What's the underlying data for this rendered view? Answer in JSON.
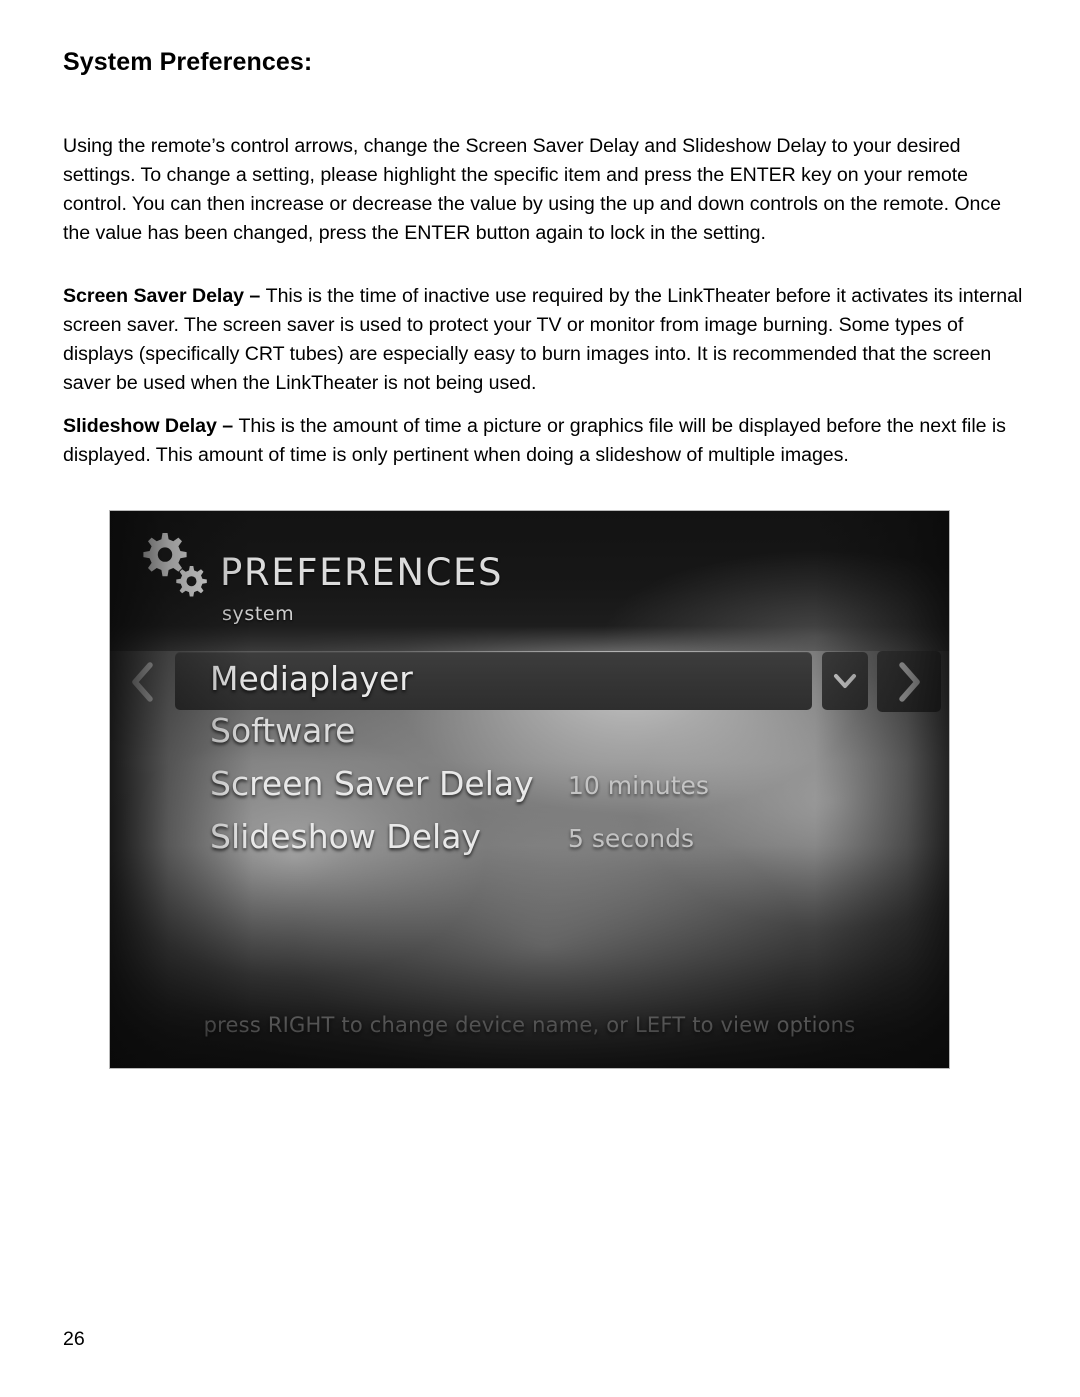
{
  "document": {
    "title": "System Preferences:",
    "paragraphs": [
      {
        "id": "intro",
        "text": "Using the remote’s control arrows, change the Screen Saver Delay and Slideshow Delay to your desired settings.  To change a setting, please highlight the specific item and press the ENTER key on your remote control.  You can then increase or decrease the value by using the up and down controls on the remote.  Once the value has been changed, press the ENTER button again to lock in the setting."
      },
      {
        "id": "screensaver",
        "lead": "Screen Saver Delay – ",
        "text": "This is the time of inactive use required by the LinkTheater before it activates its internal screen saver.  The screen saver is used to protect your TV or monitor from image burning.  Some types of displays (specifically CRT tubes) are especially easy to burn images into.  It is recommended that the screen saver be used when the LinkTheater is not being used."
      },
      {
        "id": "slideshow",
        "lead": "Slideshow Delay – ",
        "text": "This is the amount of time a picture or graphics file will be displayed before the next file is displayed.  This amount of time is only pertinent when doing a slideshow of multiple images."
      }
    ],
    "page_number": "26"
  },
  "tv_screen": {
    "brand": {
      "title": "PREFERENCES",
      "subtitle": "system",
      "icon": "gears-icon"
    },
    "nav": {
      "left_icon": "chevron-left-icon",
      "right_icon": "chevron-right-icon",
      "dropdown_icon": "chevron-down-icon"
    },
    "rows": [
      {
        "label": "Mediaplayer",
        "value": "",
        "selected": true
      },
      {
        "label": "Software",
        "value": "",
        "selected": false
      },
      {
        "label": "Screen Saver Delay",
        "value": "10 minutes",
        "selected": false
      },
      {
        "label": "Slideshow Delay",
        "value": "5 seconds",
        "selected": false
      }
    ],
    "footer_hint": "press RIGHT to change device name, or LEFT to view options",
    "colors": {
      "screen_dark": "#1b1b1b",
      "screen_light": "#7c7c7c",
      "highlight_bar": "#343434",
      "text_primary": "#e9e9e9",
      "text_secondary": "#c9c9c9"
    }
  }
}
